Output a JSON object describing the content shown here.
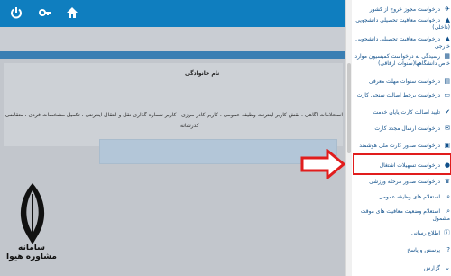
{
  "topbar": {
    "icons": [
      "home-icon",
      "key-icon",
      "power-icon"
    ]
  },
  "main": {
    "lastname_label": "نام خانوادگی",
    "notice_line1": "استعلامات آگاهی ، نقش کاربر اینترنت وظیفه عمومی ، کاربر کادر مرزی ، کاربر شماره گذاری نقل و انتقال اینترنتی ، تکمیل مشخصات فردی ، متقاضی",
    "notice_line2": "کدرشانه"
  },
  "logo": {
    "text": "سامانه مشاوره هیوا"
  },
  "sidebar": {
    "items": [
      {
        "label": "درخواست مجوز خروج از کشور",
        "icon": "plane-icon"
      },
      {
        "label": "درخواست معافیت تحصیلی دانشجویی (داخلی)",
        "icon": "graduation-icon"
      },
      {
        "label": "درخواست معافیت تحصیلی دانشجویی خارجی",
        "icon": "graduation-icon"
      },
      {
        "label": "رسیدگی به درخواست کمیسیون موارد خاص دانشگاهها(سنوات ارفاقی)",
        "icon": "building-icon"
      },
      {
        "label": "درخواست سنوات مهلت معرفی",
        "icon": "calendar-icon"
      },
      {
        "label": "درخواست برخط اصالت سنجی کارت",
        "icon": "card-icon"
      },
      {
        "label": "تایید اصالت کارت پایان خدمت",
        "icon": "check-icon"
      },
      {
        "label": "درخواست ارسال مجدد کارت",
        "icon": "mail-icon"
      },
      {
        "label": "درخواست صدور کارت ملی هوشمند",
        "icon": "id-icon"
      },
      {
        "label": "درخواست تسهیلات اشتغال",
        "icon": "briefcase-icon"
      },
      {
        "label": "درخواست صدور مرحله ورزشی",
        "icon": "trophy-icon"
      },
      {
        "label": "استعلام های وظیفه عمومی",
        "icon": "search-icon"
      },
      {
        "label": "استعلام وضعیت معافیت های موقت مشمول",
        "icon": "search-icon"
      },
      {
        "label": "اطلاع رسانی",
        "icon": "info-icon"
      },
      {
        "label": "پرسش و پاسخ",
        "icon": "question-icon"
      },
      {
        "label": "گزارش",
        "icon": "chevron-down-icon"
      }
    ]
  }
}
